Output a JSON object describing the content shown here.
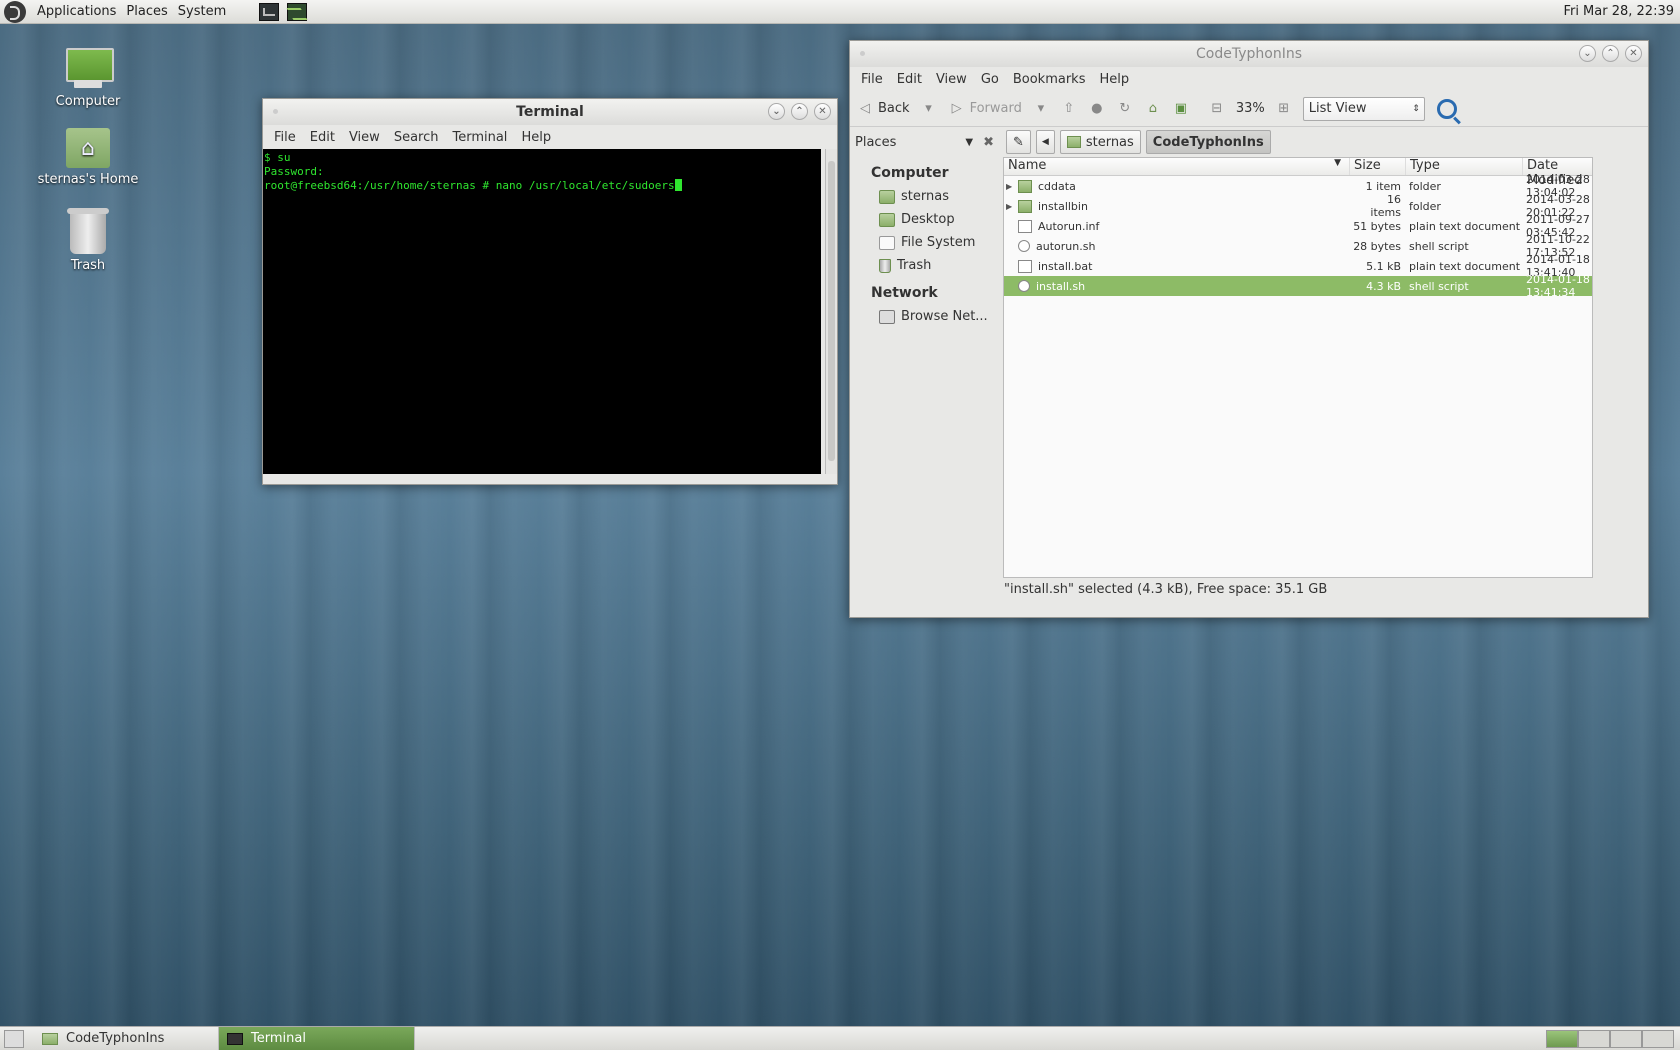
{
  "top_panel": {
    "menus": [
      "Applications",
      "Places",
      "System"
    ],
    "clock": "Fri Mar 28, 22:39"
  },
  "desktop": {
    "icons": [
      "Computer",
      "sternas's Home",
      "Trash"
    ]
  },
  "terminal": {
    "title": "Terminal",
    "menus": [
      "File",
      "Edit",
      "View",
      "Search",
      "Terminal",
      "Help"
    ],
    "lines": [
      "$ su",
      "Password:",
      "root@freebsd64:/usr/home/sternas # nano /usr/local/etc/sudoers"
    ]
  },
  "file_manager": {
    "title": "CodeTyphonIns",
    "menus": [
      "File",
      "Edit",
      "View",
      "Go",
      "Bookmarks",
      "Help"
    ],
    "toolbar": {
      "back": "Back",
      "forward": "Forward",
      "zoom": "33%",
      "view_mode": "List View"
    },
    "sidebar": {
      "header": "Places",
      "sections": [
        {
          "title": "Computer",
          "items": [
            "sternas",
            "Desktop",
            "File System",
            "Trash"
          ]
        },
        {
          "title": "Network",
          "items": [
            "Browse Net..."
          ]
        }
      ]
    },
    "path": [
      "sternas",
      "CodeTyphonIns"
    ],
    "columns": [
      "Name",
      "Size",
      "Type",
      "Date Modified"
    ],
    "files": [
      {
        "name": "cddata",
        "size": "1 item",
        "type": "folder",
        "date": "2014-03-28 13:04:02"
      },
      {
        "name": "installbin",
        "size": "16 items",
        "type": "folder",
        "date": "2014-03-28 20:01:22"
      },
      {
        "name": "Autorun.inf",
        "size": "51 bytes",
        "type": "plain text document",
        "date": "2011-09-27 03:45:42"
      },
      {
        "name": "autorun.sh",
        "size": "28 bytes",
        "type": "shell script",
        "date": "2011-10-22 17:13:52"
      },
      {
        "name": "install.bat",
        "size": "5.1 kB",
        "type": "plain text document",
        "date": "2014-01-18 13:41:40"
      },
      {
        "name": "install.sh",
        "size": "4.3 kB",
        "type": "shell script",
        "date": "2014-01-18 13:41:34"
      }
    ],
    "status": "\"install.sh\" selected (4.3 kB), Free space: 35.1 GB"
  },
  "taskbar": {
    "tasks": [
      "CodeTyphonIns",
      "Terminal"
    ]
  }
}
